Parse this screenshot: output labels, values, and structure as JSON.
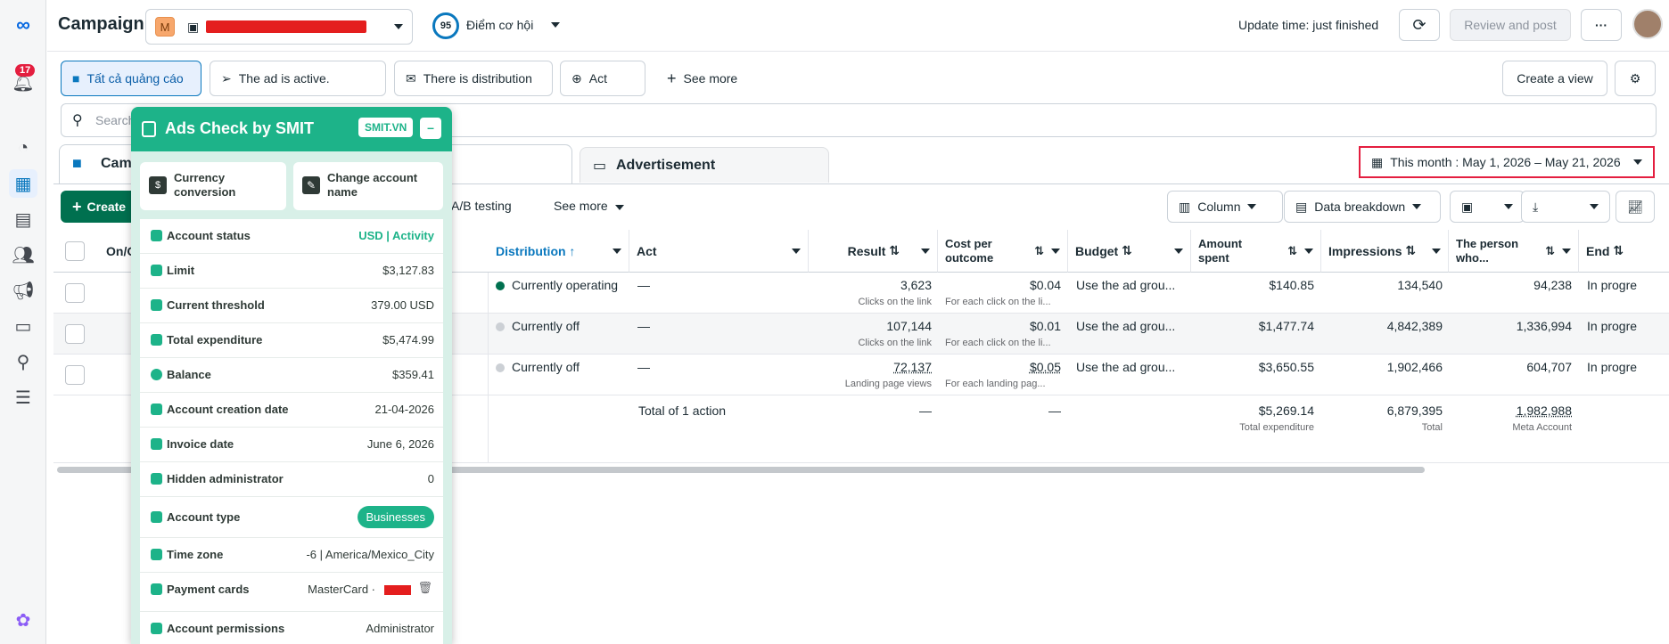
{
  "header": {
    "title": "Campaign",
    "account_avatar": "M",
    "account_name": "████████████████...",
    "opportunity_score": "95",
    "opportunity_label": "Điểm cơ hội",
    "update_time": "Update time: just finished",
    "review_post": "Review and post",
    "more": "···"
  },
  "rail": {
    "notifications_count": "17"
  },
  "filters": {
    "chips": [
      "Tất cả quảng cáo",
      "The ad is active.",
      "There is distribution",
      "Act"
    ],
    "see_more": "See more",
    "create_view": "Create a view"
  },
  "search": {
    "placeholder": "Search"
  },
  "tabs": {
    "campaign": "Cam",
    "advertisement": "Advertisement"
  },
  "date_range": "This month : May 1, 2026 – May 21, 2026",
  "toolbar": {
    "create": "Create",
    "ab_testing": "A/B testing",
    "see_more": "See more",
    "column": "Column",
    "data_breakdown": "Data breakdown"
  },
  "table": {
    "headers": {
      "on_off": "On/O",
      "distribution": "Distribution",
      "act": "Act",
      "result": "Result",
      "cost": "Cost per outcome",
      "budget": "Budget",
      "amount": "Amount spent",
      "impressions": "Impressions",
      "person": "The person who...",
      "end": "End"
    },
    "rows": [
      {
        "distribution": "Currently operating",
        "act": "—",
        "result": "3,623",
        "result_sub": "Clicks on the link",
        "cost": "$0.04",
        "cost_sub": "For each click on the li...",
        "budget": "Use the ad grou...",
        "amount": "$140.85",
        "impressions": "134,540",
        "person": "94,238",
        "end": "In progre"
      },
      {
        "distribution": "Currently off",
        "act": "—",
        "result": "107,144",
        "result_sub": "Clicks on the link",
        "cost": "$0.01",
        "cost_sub": "For each click on the li...",
        "budget": "Use the ad grou...",
        "amount": "$1,477.74",
        "impressions": "4,842,389",
        "person": "1,336,994",
        "end": "In progre"
      },
      {
        "distribution": "Currently off",
        "act": "—",
        "result": "72,137",
        "result_sub": "Landing page views",
        "cost": "$0.05",
        "cost_sub": "For each landing pag...",
        "budget": "Use the ad grou...",
        "amount": "$3,650.55",
        "impressions": "1,902,466",
        "person": "604,707",
        "end": "In progre"
      }
    ],
    "total": {
      "label": "Total of 1 action",
      "result": "—",
      "cost": "—",
      "amount": "$5,269.14",
      "amount_sub": "Total expenditure",
      "impressions": "6,879,395",
      "impressions_sub": "Total",
      "person": "1,982,988",
      "person_sub": "Meta Account"
    }
  },
  "smit": {
    "title": "Ads Check by SMIT",
    "badge": "SMIT.VN",
    "minimize": "–",
    "currency_conversion": "Currency conversion",
    "change_account_name": "Change account name",
    "rows": [
      {
        "label": "Account status",
        "value": "USD | Activity"
      },
      {
        "label": "Limit",
        "value": "$3,127.83"
      },
      {
        "label": "Current threshold",
        "value": "379.00 USD"
      },
      {
        "label": "Total expenditure",
        "value": "$5,474.99"
      },
      {
        "label": "Balance",
        "value": "$359.41"
      },
      {
        "label": "Account creation date",
        "value": "21-04-2026"
      },
      {
        "label": "Invoice date",
        "value": "June 6, 2026"
      },
      {
        "label": "Hidden administrator",
        "value": "0"
      },
      {
        "label": "Account type",
        "value": "Businesses"
      },
      {
        "label": "Time zone",
        "value": "-6 | America/Mexico_City"
      },
      {
        "label": "Payment cards",
        "value": "MasterCard ·"
      },
      {
        "label": "Account permissions",
        "value": "Administrator"
      }
    ]
  },
  "colors": {
    "accent": "#0a78be",
    "smit_green": "#1db389",
    "redact": "#e41e1e",
    "active_dot": "#00704f",
    "highlight_border": "#e41e3f"
  }
}
